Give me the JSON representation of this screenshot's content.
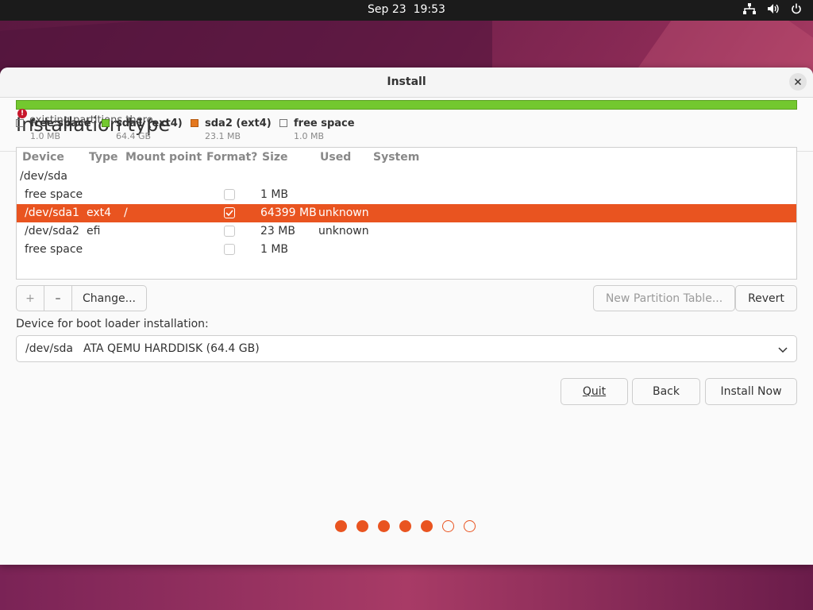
{
  "topbar": {
    "date": "Sep 23",
    "time": "19:53"
  },
  "window": {
    "title": "Install"
  },
  "page": {
    "title": "Installation type"
  },
  "warning": {
    "text": "existing partitions there."
  },
  "legend": [
    {
      "label": "free space",
      "size": "1.0 MB",
      "color": "#ffffff"
    },
    {
      "label": "sda1 (ext4)",
      "size": "64.4 GB",
      "color": "#73c82f"
    },
    {
      "label": "sda2 (ext4)",
      "size": "23.1 MB",
      "color": "#e4781f"
    },
    {
      "label": "free space",
      "size": "1.0 MB",
      "color": "#ffffff"
    }
  ],
  "table": {
    "headers": [
      "Device",
      "Type",
      "Mount point",
      "Format?",
      "Size",
      "Used",
      "System"
    ],
    "rows": [
      {
        "device": "/dev/sda",
        "type": "",
        "mount": "",
        "format": null,
        "size": "",
        "used": ""
      },
      {
        "device": "free space",
        "type": "",
        "mount": "",
        "format": false,
        "size": "1 MB",
        "used": ""
      },
      {
        "device": "/dev/sda1",
        "type": "ext4",
        "mount": "/",
        "format": true,
        "size": "64399 MB",
        "used": "unknown",
        "selected": true
      },
      {
        "device": "/dev/sda2",
        "type": "efi",
        "mount": "",
        "format": false,
        "size": "23 MB",
        "used": "unknown"
      },
      {
        "device": "free space",
        "type": "",
        "mount": "",
        "format": false,
        "size": "1 MB",
        "used": ""
      }
    ]
  },
  "toolbar": {
    "add": "+",
    "remove": "–",
    "change": "Change..."
  },
  "buttons": {
    "new_table": "New Partition Table...",
    "revert": "Revert",
    "quit": "Quit",
    "back": "Back",
    "install": "Install Now"
  },
  "boot": {
    "label": "Device for boot loader installation:",
    "device": "/dev/sda",
    "description": "ATA QEMU HARDDISK (64.4 GB)"
  },
  "progress": {
    "current_step": 5,
    "total_steps": 7
  },
  "colors": {
    "accent": "#e95420"
  }
}
